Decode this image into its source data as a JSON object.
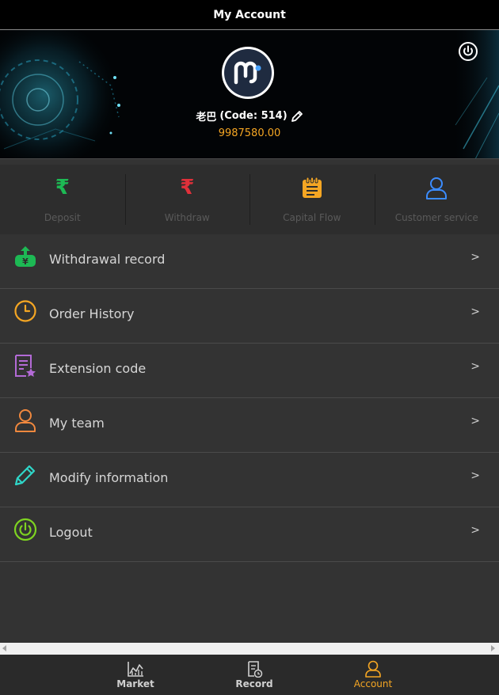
{
  "header": {
    "title": "My Account"
  },
  "profile": {
    "name": "老巴",
    "code_text": "(Code: 514)",
    "balance": "9987580.00"
  },
  "quick_actions": [
    {
      "label": "Deposit",
      "icon": "rupee-icon",
      "color": "#1db954"
    },
    {
      "label": "Withdraw",
      "icon": "rupee-icon",
      "color": "#e0303a"
    },
    {
      "label": "Capital Flow",
      "icon": "notepad-icon",
      "color": "#f5a623"
    },
    {
      "label": "Customer service",
      "icon": "user-icon",
      "color": "#3b8cff"
    }
  ],
  "menu": [
    {
      "label": "Withdrawal record",
      "icon": "cash-upload-icon",
      "arrow": ">"
    },
    {
      "label": "Order History",
      "icon": "clock-icon",
      "arrow": ">"
    },
    {
      "label": "Extension code",
      "icon": "document-star-icon",
      "arrow": ">"
    },
    {
      "label": "My team",
      "icon": "user-icon",
      "arrow": ">"
    },
    {
      "label": "Modify information",
      "icon": "pencil-icon",
      "arrow": ">"
    },
    {
      "label": "Logout",
      "icon": "power-icon",
      "arrow": ">"
    }
  ],
  "tabs": [
    {
      "label": "Market",
      "icon": "chart-icon",
      "active": false
    },
    {
      "label": "Record",
      "icon": "receipt-icon",
      "active": false
    },
    {
      "label": "Account",
      "icon": "user-icon",
      "active": true
    }
  ],
  "colors": {
    "accent": "#f5a623",
    "background": "#333333",
    "header": "#000000"
  }
}
